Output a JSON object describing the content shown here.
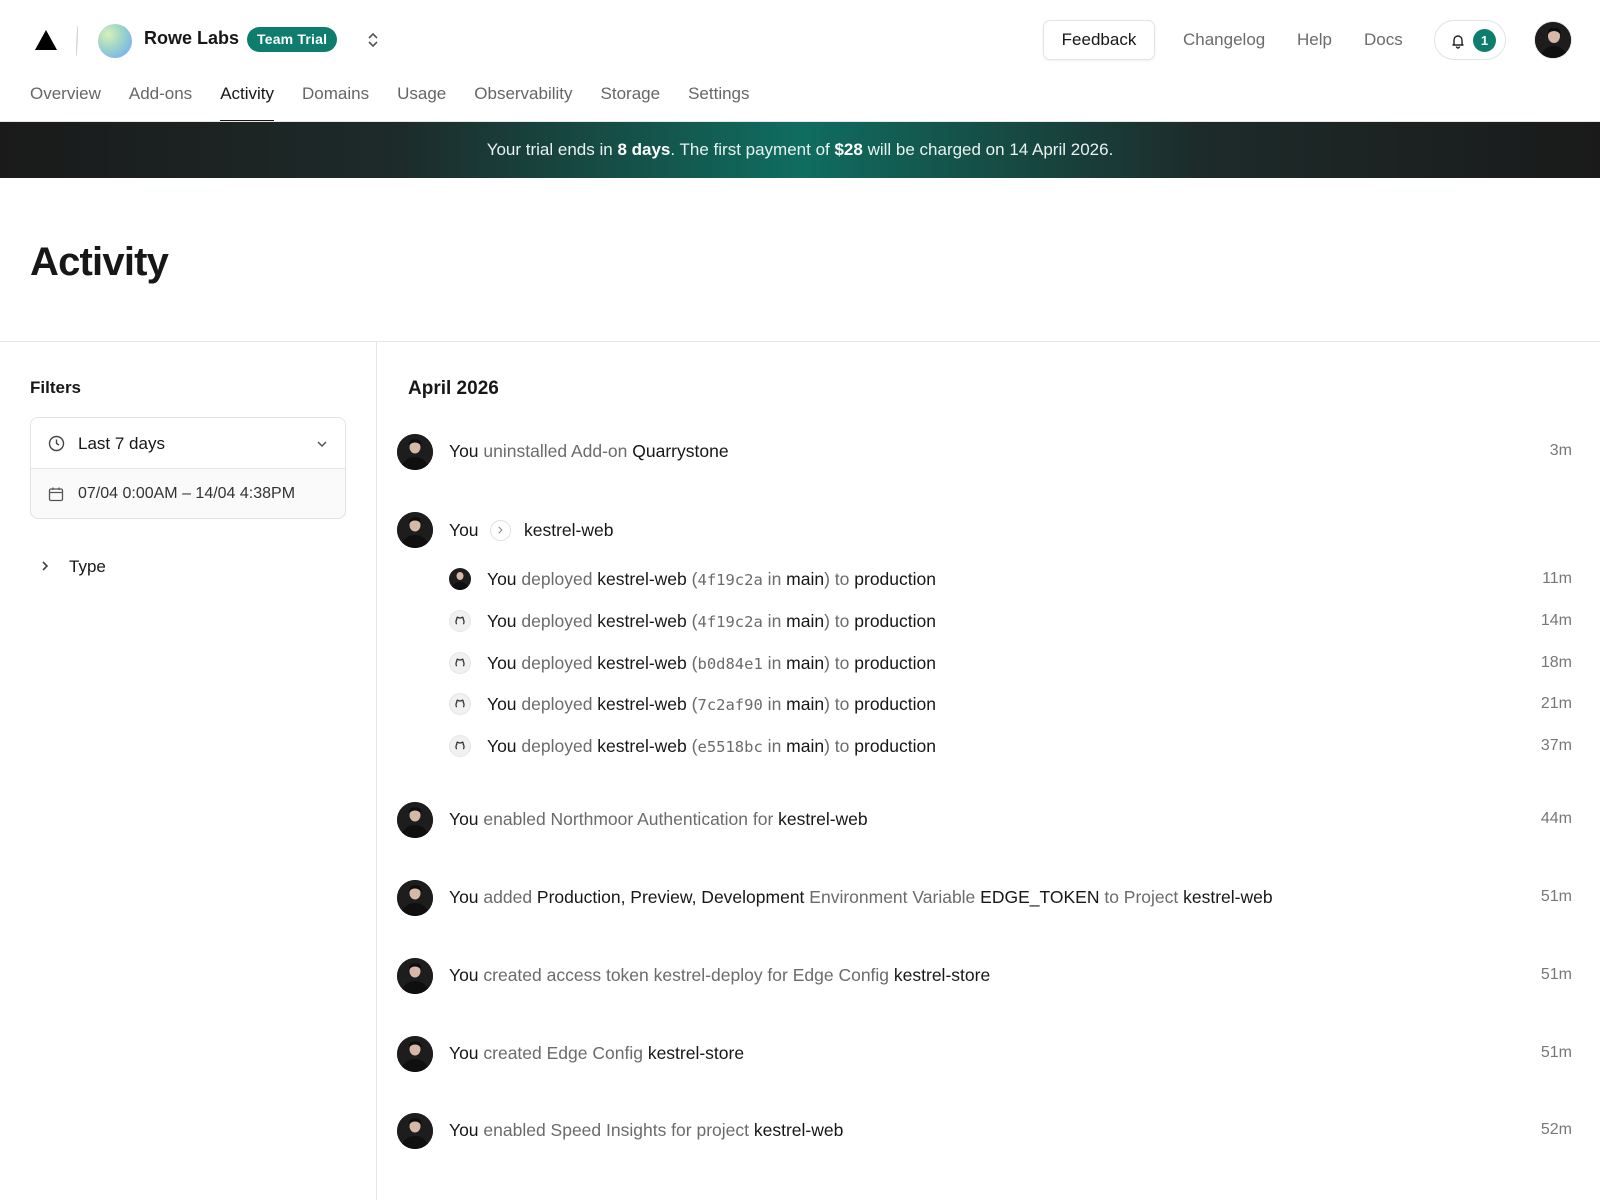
{
  "header": {
    "team_name": "Rowe Labs",
    "plan_badge": "Team Trial",
    "feedback_label": "Feedback",
    "links": [
      "Changelog",
      "Help",
      "Docs"
    ],
    "notification_count": "1"
  },
  "tabs": [
    {
      "label": "Overview",
      "active": false
    },
    {
      "label": "Add-ons",
      "active": false
    },
    {
      "label": "Activity",
      "active": true
    },
    {
      "label": "Domains",
      "active": false
    },
    {
      "label": "Usage",
      "active": false
    },
    {
      "label": "Observability",
      "active": false
    },
    {
      "label": "Storage",
      "active": false
    },
    {
      "label": "Settings",
      "active": false
    }
  ],
  "banner": {
    "prefix": "Your trial ends in ",
    "days": "8 days",
    "middle": ". The first payment of ",
    "amount": "$28",
    "suffix": " will be charged on 14 April 2026."
  },
  "page": {
    "title": "Activity"
  },
  "filters": {
    "title": "Filters",
    "range_label": "Last 7 days",
    "date_range": "07/04 0:00AM – 14/04 4:38PM",
    "type_label": "Type"
  },
  "activity": {
    "month": "April 2026",
    "actor": "You",
    "item1": {
      "verb": " uninstalled Add-on ",
      "target": "Quarrystone",
      "time": "3m"
    },
    "group": {
      "project": "kestrel-web",
      "deploys": [
        {
          "verb": " deployed ",
          "project": "kestrel-web",
          "commit": "4f19c2a",
          "in": " in ",
          "branch": "main",
          "to": ") to ",
          "env": "production",
          "time": "11m"
        },
        {
          "verb": " deployed ",
          "project": "kestrel-web",
          "commit": "4f19c2a",
          "in": " in ",
          "branch": "main",
          "to": ") to ",
          "env": "production",
          "time": "14m"
        },
        {
          "verb": " deployed ",
          "project": "kestrel-web",
          "commit": "b0d84e1",
          "in": " in ",
          "branch": "main",
          "to": ") to ",
          "env": "production",
          "time": "18m"
        },
        {
          "verb": " deployed ",
          "project": "kestrel-web",
          "commit": "7c2af90",
          "in": " in ",
          "branch": "main",
          "to": ") to ",
          "env": "production",
          "time": "21m"
        },
        {
          "verb": " deployed ",
          "project": "kestrel-web",
          "commit": "e5518bc",
          "in": " in ",
          "branch": "main",
          "to": ") to ",
          "env": "production",
          "time": "37m"
        }
      ]
    },
    "item3": {
      "verb": " enabled Northmoor Authentication for ",
      "target": "kestrel-web",
      "time": "44m"
    },
    "item4": {
      "verb": " added ",
      "envs": "Production, Preview, Development",
      "mid": " Environment Variable ",
      "var": "EDGE_TOKEN",
      "mid2": " to Project ",
      "target": "kestrel-web",
      "time": "51m"
    },
    "item5": {
      "verb": " created access token kestrel-deploy for Edge Config ",
      "target": "kestrel-store",
      "time": "51m"
    },
    "item6": {
      "verb": " created Edge Config ",
      "target": "kestrel-store",
      "time": "51m"
    },
    "item7": {
      "verb": " enabled Speed Insights for project ",
      "target": "kestrel-web",
      "time": "52m"
    }
  }
}
